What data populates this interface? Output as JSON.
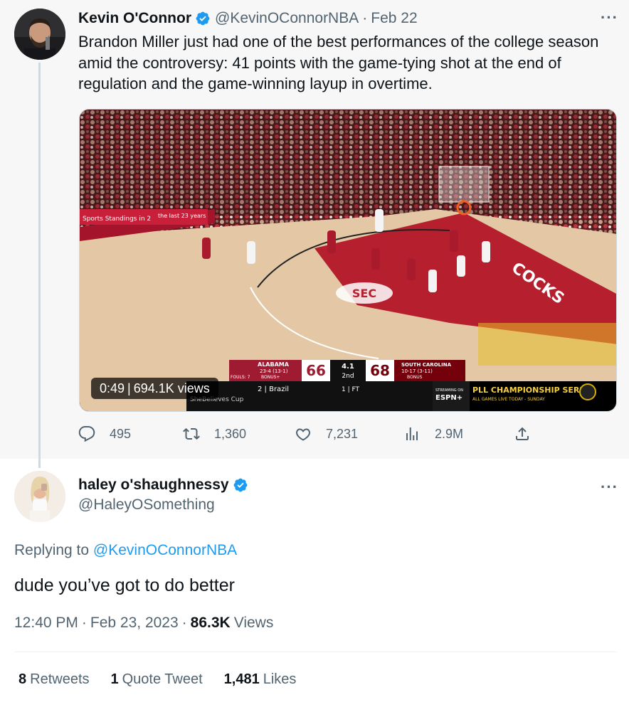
{
  "parent_tweet": {
    "author_name": "Kevin O'Connor",
    "author_handle": "@KevinOConnorNBA",
    "date": "Feb 22",
    "text": "Brandon Miller just had one of the best performances of the college season amid the controversy: 41 points with the game-tying shot at the end of regulation and the game-winning layup in overtime.",
    "more_label": "···",
    "video": {
      "duration": "0:49",
      "views": "694.1K views",
      "scoreboard": {
        "away_team": "ALABAMA",
        "away_record": "23-4 (13-1)",
        "away_bonus": "BONUS+",
        "away_fouls": "FOULS: 7",
        "away_score": "66",
        "clock": "4.1",
        "period": "2nd",
        "home_score": "68",
        "home_team": "SOUTH CAROLINA",
        "home_record": "10-17 (3-11)",
        "home_bonus": "BONUS",
        "ticker_left": "2 | Brazil",
        "ticker_right": "1 | FT",
        "ticker_sub": "SheBelieves Cup",
        "ad_text": "PLL CHAMPIONSHIP SERIES",
        "ad_sub": "ALL GAMES LIVE TODAY - SUNDAY",
        "streaming": "STREAMING ON",
        "network": "ESPN+",
        "banner": "Sports Standings in 2",
        "banner2": "the last 23 years",
        "court_logo": "SEC",
        "court_word": "COCKS"
      }
    },
    "actions": {
      "replies": "495",
      "retweets": "1,360",
      "likes": "7,231",
      "views": "2.9M"
    }
  },
  "reply_tweet": {
    "author_name": "haley o'shaughnessy",
    "author_handle": "@HaleyOSomething",
    "more_label": "···",
    "replying_prefix": "Replying to ",
    "replying_to": "@KevinOConnorNBA",
    "text": "dude you’ve got to do better",
    "time": "12:40 PM",
    "date": "Feb 23, 2023",
    "views_count": "86.3K",
    "views_label": "Views",
    "stats": {
      "retweets_count": "8",
      "retweets_label": "Retweets",
      "quotes_count": "1",
      "quotes_label": "Quote Tweet",
      "likes_count": "1,481",
      "likes_label": "Likes"
    }
  },
  "colors": {
    "verified_blue": "#1d9bf0",
    "muted_text": "#536471",
    "alabama_red": "#9e1b32",
    "gamecock_garnet": "#73000a"
  },
  "icons": [
    "verified-badge-icon",
    "reply-icon",
    "retweet-icon",
    "like-icon",
    "views-icon",
    "share-icon",
    "more-icon"
  ]
}
